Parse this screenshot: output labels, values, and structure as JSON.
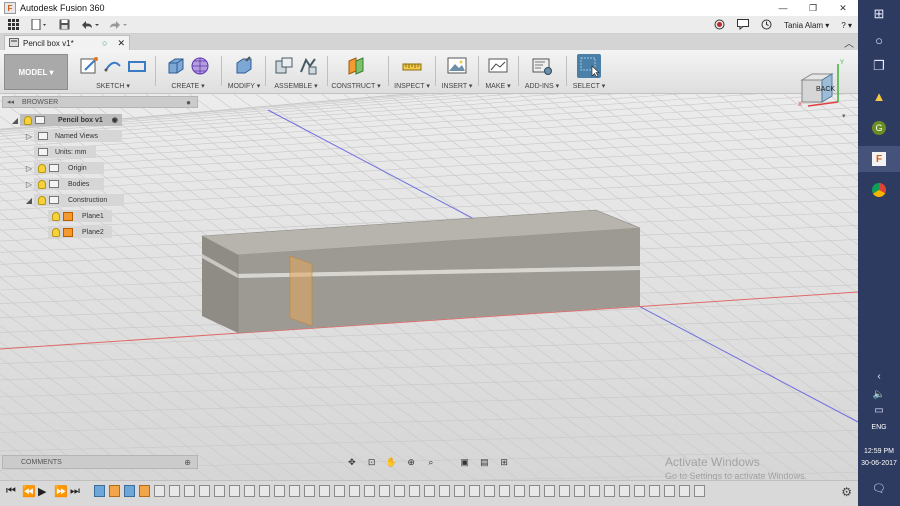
{
  "window": {
    "title": "Autodesk Fusion 360",
    "min": "—",
    "max": "❐",
    "close": "✕"
  },
  "user": {
    "name": "Tania Alam ▾",
    "help": "? ▾"
  },
  "doc_tab": {
    "label": "Pencil box v1*"
  },
  "toolbar": {
    "mode": "MODEL ▾",
    "groups": [
      {
        "label": "SKETCH ▾"
      },
      {
        "label": "CREATE ▾"
      },
      {
        "label": "MODIFY ▾"
      },
      {
        "label": "ASSEMBLE ▾"
      },
      {
        "label": "CONSTRUCT ▾"
      },
      {
        "label": "INSPECT ▾"
      },
      {
        "label": "INSERT ▾"
      },
      {
        "label": "MAKE ▾"
      },
      {
        "label": "ADD-INS ▾"
      },
      {
        "label": "SELECT ▾"
      }
    ]
  },
  "viewcube": {
    "face": "BACK",
    "axis_x": "X",
    "axis_y": "Y",
    "axis_z": "Z"
  },
  "browser": {
    "title": "BROWSER",
    "root": "Pencil box v1",
    "items": [
      {
        "label": "Named Views"
      },
      {
        "label": "Units: mm"
      },
      {
        "label": "Origin"
      },
      {
        "label": "Bodies"
      },
      {
        "label": "Construction"
      },
      {
        "label": "Plane1"
      },
      {
        "label": "Plane2"
      }
    ]
  },
  "comments": {
    "title": "COMMENTS"
  },
  "watermark": {
    "line1": "Activate Windows",
    "line2": "Go to Settings to activate Windows."
  },
  "taskbar": {
    "lang": "ENG",
    "time": "12:59 PM",
    "date": "30-06-2017"
  },
  "colors": {
    "toolbar_active": "#4a7fa8",
    "taskbar": "#2e3b61",
    "plane": "#f59a2f"
  }
}
